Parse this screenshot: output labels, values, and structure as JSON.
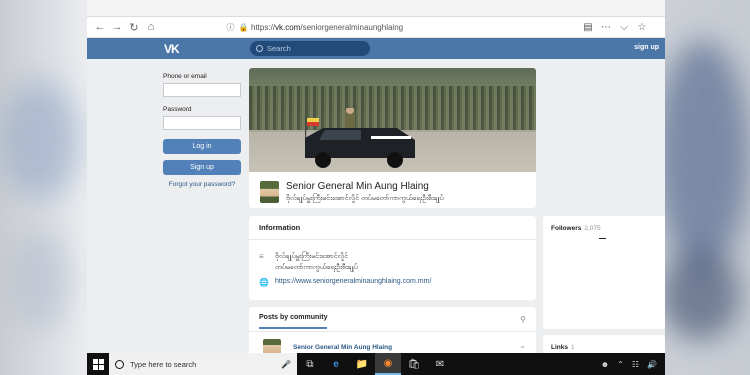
{
  "browser": {
    "url_scheme": "https://",
    "url_host": "vk.com",
    "url_path": "/seniorgeneralminaunghlaing"
  },
  "vk": {
    "logo": "VK",
    "search_placeholder": "Search",
    "signup_top": "sign up"
  },
  "login": {
    "phone_label": "Phone or email",
    "password_label": "Password",
    "login_button": "Log in",
    "signup_button": "Sign up",
    "forgot_link": "Forgot your password?"
  },
  "profile": {
    "name": "Senior General Min Aung Hlaing",
    "status": "ဗိုလ်ချုပ်မှူးကြီးမင်းအောင်လှိုင် တပ်မတော်ကာကွယ်ရေးဦးစီးချုပ်"
  },
  "info": {
    "heading": "Information",
    "description_line1": "ဗိုလ်ချုပ်မှူးကြီးမင်းအောင်လှိုင်",
    "description_line2": "တပ်မတော်ကာကွယ်ရေးဦးစီးချုပ်",
    "website": "https://www.seniorgeneralminaunghlaing.com.mm/"
  },
  "posts": {
    "tab_label": "Posts by community",
    "author": "Senior General Min Aung Hlaing"
  },
  "followers": {
    "label": "Followers",
    "count": "2,075"
  },
  "links": {
    "label": "Links",
    "count": "1"
  },
  "taskbar": {
    "search_placeholder": "Type here to search"
  },
  "colors": {
    "vk_blue": "#4a76a8",
    "button_blue": "#5181b8",
    "link_blue": "#2a5885"
  }
}
